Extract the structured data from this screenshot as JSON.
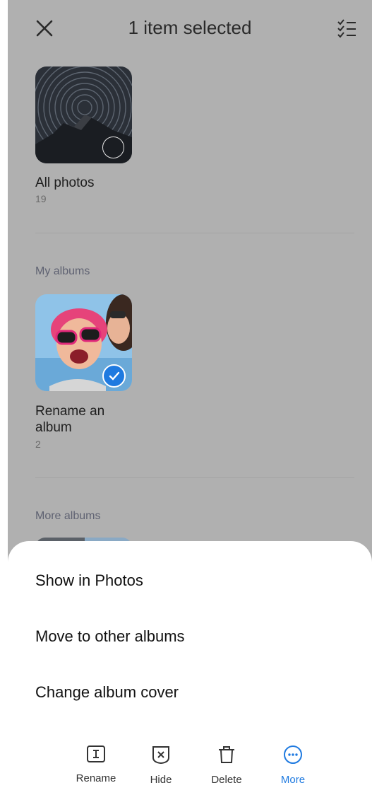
{
  "header": {
    "title": "1 item selected",
    "close_icon": "close-icon",
    "select_all_icon": "checklist-icon"
  },
  "all_photos": {
    "name": "All photos",
    "count": "19",
    "selected": false
  },
  "my_albums": {
    "label": "My albums",
    "albums": [
      {
        "name": "Rename an album",
        "count": "2",
        "selected": true
      }
    ]
  },
  "more_albums": {
    "label": "More albums"
  },
  "sheet": {
    "items": [
      {
        "label": "Show in Photos"
      },
      {
        "label": "Move to other albums"
      },
      {
        "label": "Change album cover"
      }
    ]
  },
  "actions": [
    {
      "label": "Rename",
      "icon": "rename-icon"
    },
    {
      "label": "Hide",
      "icon": "hide-icon"
    },
    {
      "label": "Delete",
      "icon": "trash-icon"
    },
    {
      "label": "More",
      "icon": "more-icon",
      "active": true
    }
  ],
  "colors": {
    "accent": "#1f7ae0",
    "overlay": "#b0b0b0"
  }
}
